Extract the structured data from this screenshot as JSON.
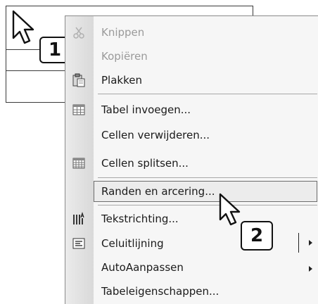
{
  "menu": {
    "items": [
      {
        "label": "Knippen",
        "icon": "scissors-icon",
        "disabled": true
      },
      {
        "label": "Kopiëren",
        "icon": "copy-icon",
        "disabled": true
      },
      {
        "label": "Plakken",
        "icon": "paste-icon",
        "disabled": false
      },
      {
        "label": "Tabel invoegen...",
        "icon": "insert-table-icon",
        "disabled": false
      },
      {
        "label": "Cellen verwijderen...",
        "icon": "",
        "disabled": false
      },
      {
        "label": "Cellen splitsen...",
        "icon": "split-cells-icon",
        "disabled": false
      },
      {
        "label": "Randen en arcering...",
        "icon": "",
        "disabled": false,
        "highlighted": true
      },
      {
        "label": "Tekstrichting...",
        "icon": "text-direction-icon",
        "disabled": false
      },
      {
        "label": "Celuitlijning",
        "icon": "cell-alignment-icon",
        "disabled": false,
        "submenu": true
      },
      {
        "label": "AutoAanpassen",
        "icon": "",
        "disabled": false,
        "submenu": true
      },
      {
        "label": "Tabeleigenschappen...",
        "icon": "",
        "disabled": false
      }
    ]
  },
  "badges": {
    "step1": "1",
    "step2": "2"
  }
}
